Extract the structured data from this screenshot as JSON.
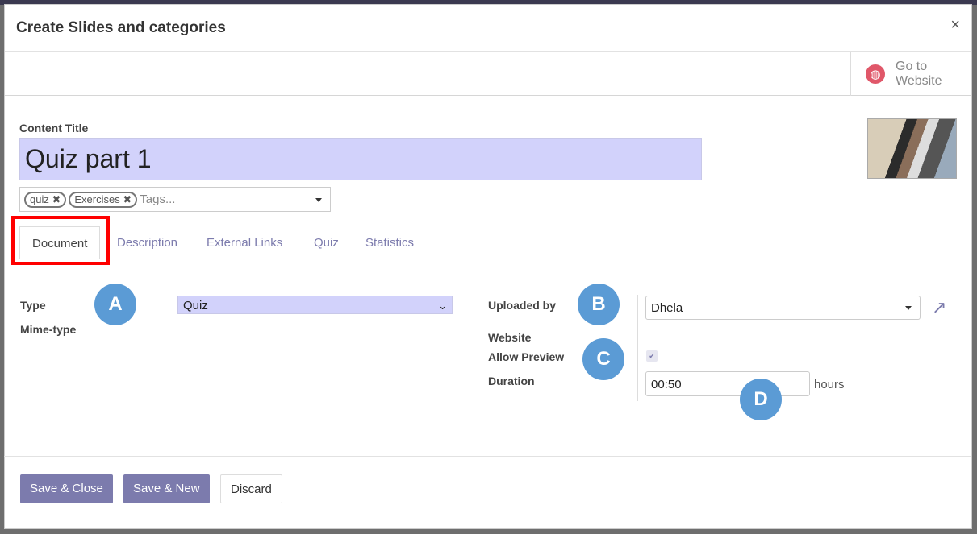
{
  "dialog": {
    "title": "Create Slides and categories",
    "close": "×"
  },
  "button_box": {
    "go_to_website": "Go to Website"
  },
  "form": {
    "content_title_label": "Content Title",
    "content_title_value": "Quiz part 1",
    "tags": [
      "quiz",
      "Exercises"
    ],
    "tags_placeholder": "Tags...",
    "tabs": [
      "Document",
      "Description",
      "External Links",
      "Quiz",
      "Statistics"
    ],
    "active_tab": "Document",
    "type_label": "Type",
    "type_value": "Quiz",
    "mime_label": "Mime-type",
    "uploaded_by_label": "Uploaded by",
    "uploaded_by_value": "Dhela",
    "website_label": "Website",
    "allow_preview_label": "Allow Preview",
    "allow_preview_checked": true,
    "duration_label": "Duration",
    "duration_value": "00:50",
    "duration_unit": "hours"
  },
  "annotations": [
    "A",
    "B",
    "C",
    "D"
  ],
  "footer": {
    "save_close": "Save & Close",
    "save_new": "Save & New",
    "discard": "Discard"
  },
  "colors": {
    "accent": "#7c7bad",
    "highlight": "#d2d2fb",
    "badge": "#5b9bd5",
    "callout": "#ff0000"
  }
}
